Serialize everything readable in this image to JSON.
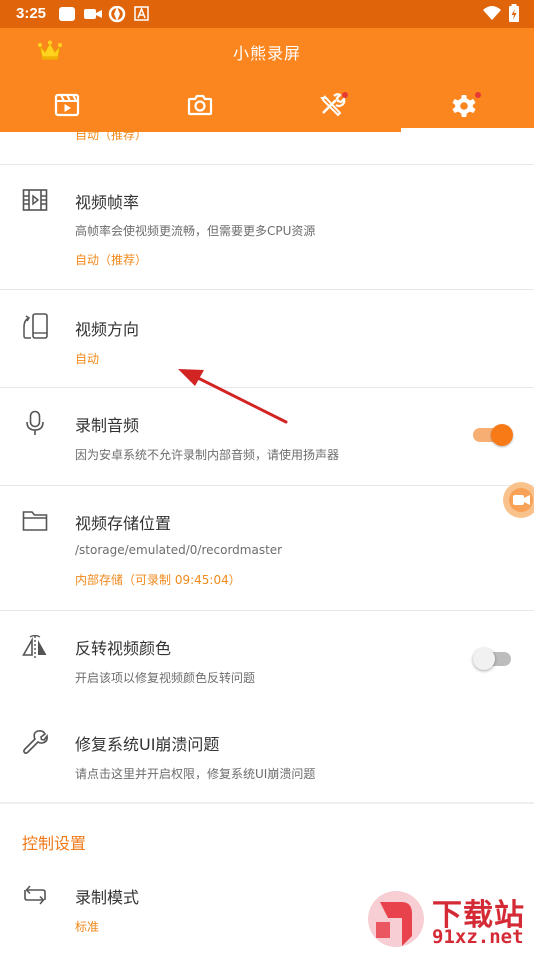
{
  "status_bar": {
    "time": "3:25"
  },
  "header": {
    "title": "小熊录屏",
    "tabs": [
      {
        "name": "videos"
      },
      {
        "name": "screenshots"
      },
      {
        "name": "tools"
      },
      {
        "name": "settings",
        "active": true
      }
    ]
  },
  "settings": {
    "prev_value_partial": "自动（推荐）",
    "frame_rate": {
      "title": "视频帧率",
      "subtitle": "高帧率会使视频更流畅，但需要更多CPU资源",
      "value": "自动（推荐）"
    },
    "orientation": {
      "title": "视频方向",
      "value": "自动"
    },
    "record_audio": {
      "title": "录制音频",
      "subtitle": "因为安卓系统不允许录制内部音频，请使用扬声器",
      "enabled": true
    },
    "storage": {
      "title": "视频存储位置",
      "path": "/storage/emulated/0/recordmaster",
      "value": "内部存储（可录制 09:45:04）"
    },
    "invert_color": {
      "title": "反转视频颜色",
      "subtitle": "开启该项以修复视频颜色反转问题",
      "enabled": false
    },
    "fix_ui": {
      "title": "修复系统UI崩溃问题",
      "subtitle": "请点击这里并开启权限，修复系统UI崩溃问题"
    },
    "control_section": "控制设置",
    "record_mode": {
      "title": "录制模式",
      "value": "标准"
    }
  },
  "watermark": {
    "text_cn": "下载站",
    "text_en": "91xz.net"
  },
  "colors": {
    "accent": "#fb861f",
    "status_bar": "#e0650a",
    "value_text": "#f2891b",
    "annotation_arrow": "#d32424"
  }
}
